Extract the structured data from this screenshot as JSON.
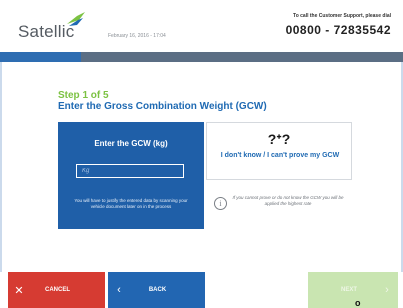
{
  "header": {
    "brand": "Satellic",
    "date": "February 16, 2016 - 17:04",
    "support_label": "To call the Customer Support, please dial",
    "support_phone": "00800 - 72835542"
  },
  "progress": {
    "fraction": 0.2
  },
  "main": {
    "step": "Step 1 of 5",
    "title": "Enter the Gross Combination Weight (GCW)",
    "gcw_card": {
      "title": "Enter the GCW (kg)",
      "input_placeholder": "Kg",
      "input_value": "",
      "note": "You will have to justify the entered data by scanning your vehicle document later on in the process"
    },
    "unknown_card": {
      "icon": "question-icon",
      "label": "I don't know / I can't prove my GCW",
      "info_icon": "info-icon",
      "note": "If you cannot prove or do not know the GCW you will be applied the highest rate"
    }
  },
  "footer": {
    "cancel_label": "CANCEL",
    "back_label": "BACK",
    "next_label": "NEXT",
    "cancel_icon": "close-icon",
    "back_icon": "chevron-left-icon",
    "next_icon": "chevron-right-icon"
  },
  "colors": {
    "accent_blue": "#1f5fa8",
    "step_green": "#7cc242",
    "cancel_red": "#d63b32",
    "next_disabled": "#c9e5b1"
  }
}
